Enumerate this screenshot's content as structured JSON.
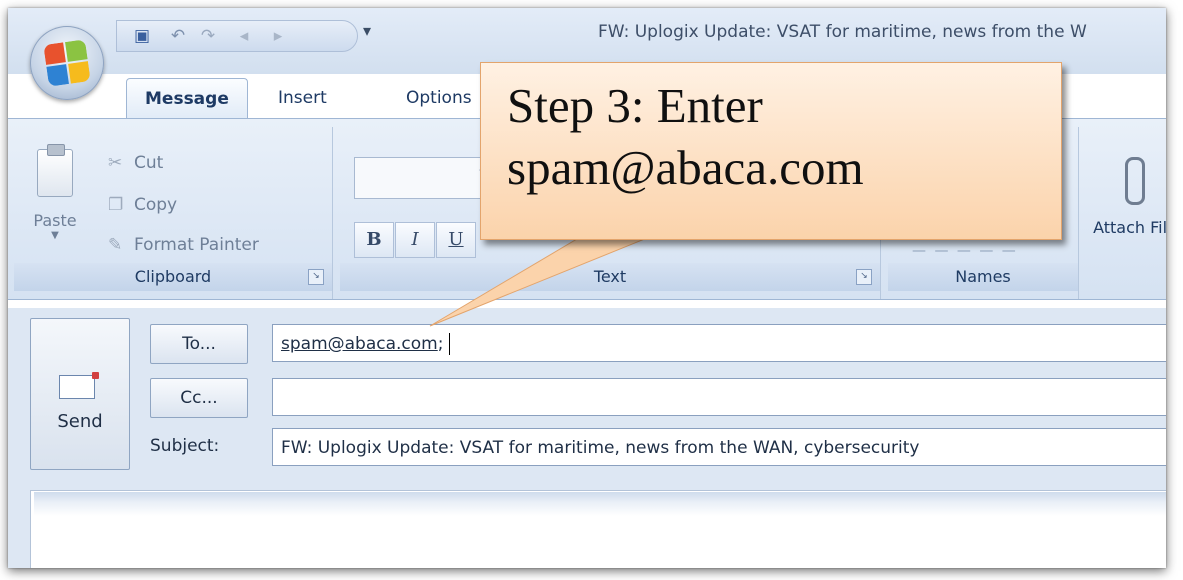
{
  "window": {
    "title": "FW: Uplogix Update: VSAT for maritime, news from the W"
  },
  "quick_access": {
    "icons": [
      "save-icon",
      "undo-icon",
      "redo-icon",
      "previous-icon",
      "next-icon"
    ],
    "customize": "▾"
  },
  "tabs": [
    {
      "label": "Message",
      "active": true
    },
    {
      "label": "Insert",
      "active": false
    },
    {
      "label": "Options",
      "active": false
    }
  ],
  "ribbon": {
    "clipboard": {
      "label": "Clipboard",
      "paste": "Paste",
      "cut": "Cut",
      "copy": "Copy",
      "format_painter": "Format Painter"
    },
    "basic_text": {
      "bold": "B",
      "italic": "I",
      "underline": "U",
      "label": "Text"
    },
    "names": {
      "label": "Names"
    },
    "include": {
      "attach_file": "Attach File"
    }
  },
  "compose": {
    "send_label": "Send",
    "to_button": "To...",
    "cc_button": "Cc...",
    "subject_label": "Subject:",
    "to_value": "spam@abaca.com",
    "to_separator": ";",
    "cc_value": "",
    "subject_value": "FW: Uplogix Update: VSAT for maritime, news from the WAN, cybersecurity"
  },
  "callout": {
    "line1": "Step 3: Enter",
    "line2": "spam@abaca.com",
    "fill_color": "#fbd3ab",
    "border_color": "#e3a46c"
  }
}
